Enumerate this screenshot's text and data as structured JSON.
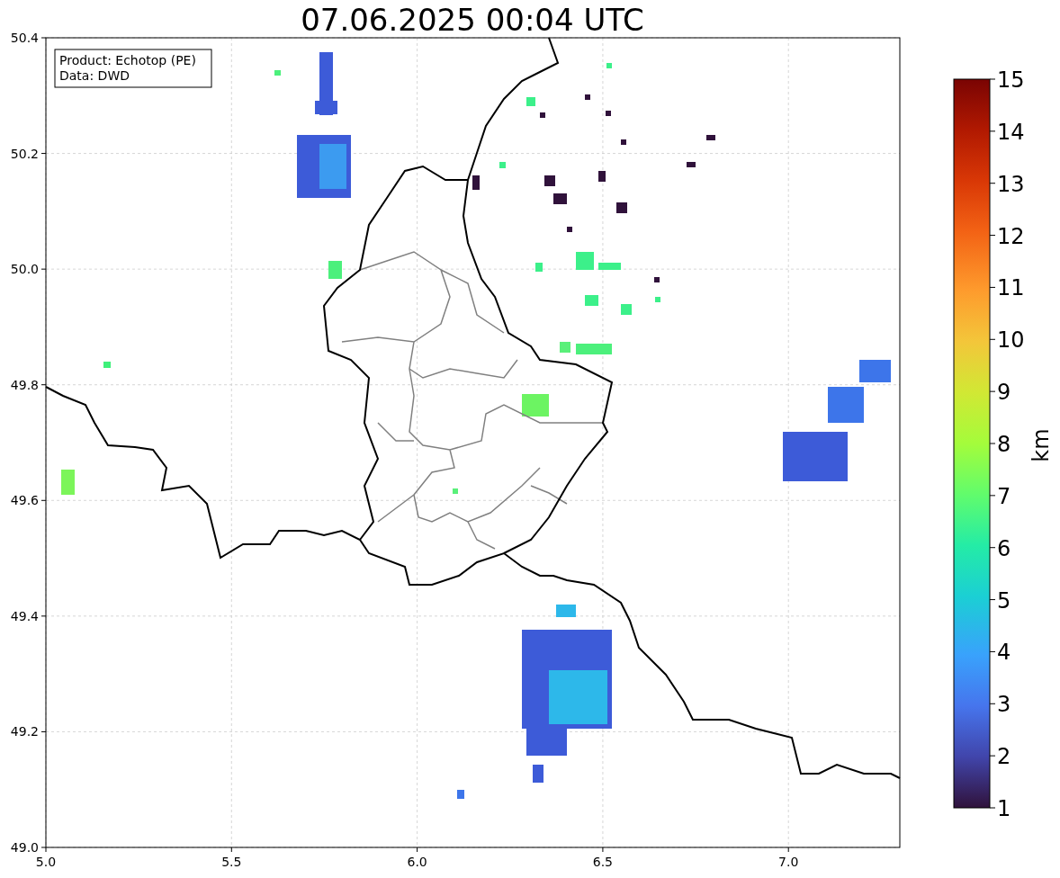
{
  "title": "07.06.2025 00:04 UTC",
  "legend": [
    "Product: Echotop (PE)",
    "Data: DWD"
  ],
  "x_ticks": [
    "5.0",
    "5.5",
    "6.0",
    "6.5",
    "7.0"
  ],
  "y_ticks": [
    "50.4",
    "50.2",
    "50.0",
    "49.8",
    "49.6",
    "49.4",
    "49.2",
    "49.0"
  ],
  "colorbar": {
    "label": "km",
    "ticks": [
      "15",
      "14",
      "13",
      "12",
      "11",
      "10",
      "9",
      "8",
      "7",
      "6",
      "5",
      "4",
      "3",
      "2",
      "1"
    ]
  }
}
